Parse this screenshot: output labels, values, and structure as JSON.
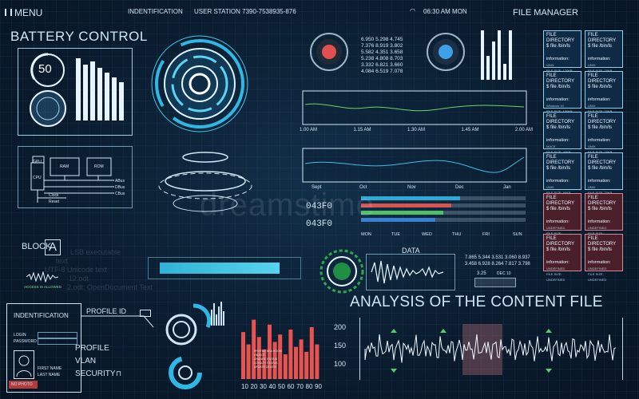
{
  "topbar": {
    "menu_label": "MENU",
    "identification": "INDENTIFICATION",
    "user_station": "USER  STATION 7390-7538935-876",
    "clock": "06:30 AM MON",
    "file_manager": "FILE MANAGER"
  },
  "battery": {
    "title": "BATTERY CONTROL",
    "level": "50"
  },
  "circuit": {
    "gpu": "GPU",
    "cpu": "CPU",
    "ram": "RAM",
    "rom": "ROM",
    "abus": "ABus",
    "dbus": "DBus",
    "cbus": "CBus",
    "clock": "Clock",
    "reset": "Reset"
  },
  "block": {
    "label": "BLOCK",
    "letter": "A",
    "access": "ACCESS IS ALLOWED"
  },
  "bg_text": [
    "LSB executable",
    "text",
    "UTF-8 Unicode text",
    "12.odt",
    "2.odt: OpenDocument Text"
  ],
  "numbers_block": [
    "6.950 5.298 4.745",
    "7.376 8.919 3.802",
    "5.582 4.351 3.658",
    "5.238 4.808 8.703",
    "3.332 6.821 3.660",
    "4.084 6.519 7.078"
  ],
  "line_chart1": {
    "ticks": [
      "1.00 AM",
      "1.15 AM",
      "1.30 AM",
      "1.45 AM",
      "2.00 AM"
    ]
  },
  "line_chart2": {
    "ticks": [
      "Sept",
      "Oct",
      "Nov",
      "Dec",
      "Jan"
    ]
  },
  "hex_codes": [
    "043F0",
    "043F0"
  ],
  "weekdays": [
    "MON",
    "TUE",
    "WED",
    "THU",
    "FRI",
    "SUN"
  ],
  "progress_bars": [
    {
      "fill": 0.6,
      "color": "#2fa9d6"
    },
    {
      "fill": 0.55,
      "color": "#d9534f"
    },
    {
      "fill": 0.5,
      "color": "#4fbf6a"
    },
    {
      "fill": 0.45,
      "color": "#3a7fd0"
    }
  ],
  "data_panel": {
    "title": "DATA",
    "rows": [
      "7.865 5.344 3.531 3.060 8.937",
      "3.458 6.928 8.264 7.817 3.798"
    ],
    "value": "3.25",
    "dec": "DEC 10"
  },
  "analysis": {
    "title": "ANALYSIS OF THE CONTENT FILE"
  },
  "identification": {
    "title": "INDENTIFICATION",
    "login": "LOGIN",
    "password": "PASSWORD",
    "first_name": "FIRST NAME",
    "last_name": "LAST NAME",
    "no_photo": "NO PHOTO"
  },
  "profile": {
    "profile_id": "PROFILE  ID",
    "profile": "PROFILE",
    "vlan": "VLAN",
    "security": "SECURITY"
  },
  "bar_chart": {
    "ticks": [
      "200",
      "150",
      "100"
    ],
    "categories": [
      "10",
      "20",
      "30",
      "40",
      "50",
      "60",
      "70",
      "80",
      "90"
    ]
  },
  "legend_small": [
    "PROFILE BSA  HOOM",
    "OBJECT",
    "CHANGE STATUS",
    "LOYALTY STATUS",
    "UPDATE DELETE"
  ],
  "file_cards": [
    {
      "title": "FILE DIRECTORY",
      "path": "$ file /bin/ls",
      "info": "information:",
      "sub": "UNIX",
      "size": "FILE SIZE: 170KB",
      "red": false
    },
    {
      "title": "FILE DIRECTORY",
      "path": "$ file /bin/ls",
      "info": "information:",
      "sub": "UNIX",
      "size": "FILE SIZE: 70KB",
      "red": false
    },
    {
      "title": "FILE DIRECTORY",
      "path": "$ file /bin/ls",
      "info": "information:",
      "sub": "Windows 10",
      "size": "FILE SIZE: 150KB",
      "red": false
    },
    {
      "title": "FILE DIRECTORY",
      "path": "$ file /bin/ls",
      "info": "information:",
      "sub": "UNIX",
      "size": "FILE SIZE: 70KB",
      "red": false
    },
    {
      "title": "FILE DIRECTORY",
      "path": "$ file /bin/ls",
      "info": "information:",
      "sub": "MACE",
      "size": "FILE SIZE: 40KB",
      "red": false
    },
    {
      "title": "FILE DIRECTORY",
      "path": "$ file /bin/ls",
      "info": "information:",
      "sub": "UNIX",
      "size": "FILE SIZE: 70KB",
      "red": false
    },
    {
      "title": "FILE DIRECTORY",
      "path": "$ file /bin/ls",
      "info": "information:",
      "sub": "UNIX",
      "size": "FILE SIZE: 50KB",
      "red": false
    },
    {
      "title": "FILE DIRECTORY",
      "path": "$ file /bin/ls",
      "info": "information:",
      "sub": "UNIX",
      "size": "FILE SIZE: 70KB",
      "red": false
    },
    {
      "title": "FILE DIRECTORY",
      "path": "$ file /bin/ls",
      "info": "information:",
      "sub": "UNDEFINED",
      "size": "FILE SIZE: UNDEFINED",
      "red": true
    },
    {
      "title": "FILE DIRECTORY",
      "path": "$ file /bin/ls",
      "info": "information:",
      "sub": "UNDEFINED",
      "size": "FILE SIZE: UNDEFINED",
      "red": true
    },
    {
      "title": "FILE DIRECTORY",
      "path": "$ file /bin/ls",
      "info": "information:",
      "sub": "UNDEFINED",
      "size": "FILE SIZE: UNDEFINED",
      "red": true
    },
    {
      "title": "FILE DIRECTORY",
      "path": "$ file /bin/ls",
      "info": "information:",
      "sub": "UNDEFINED",
      "size": "FILE SIZE: UNDEFINED",
      "red": true
    }
  ],
  "colors": {
    "accent": "#39c6ef",
    "red": "#e8534f",
    "green": "#4fd06a"
  },
  "watermark": "dreamstime"
}
